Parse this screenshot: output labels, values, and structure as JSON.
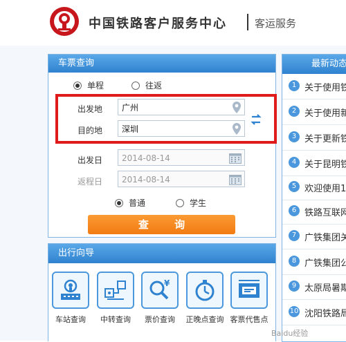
{
  "header": {
    "title": "中国铁路客户服务中心",
    "subtitle": "客运服务"
  },
  "ticket_query": {
    "panel_title": "车票查询",
    "trip_types": [
      "单程",
      "往返"
    ],
    "selected_trip_type": "单程",
    "from_label": "出发地",
    "from_value": "广州",
    "to_label": "目的地",
    "to_value": "深圳",
    "depart_label": "出发日",
    "depart_value": "2014-08-14",
    "return_label": "返程日",
    "return_value": "2014-08-14",
    "passenger_types": [
      "普通",
      "学生"
    ],
    "selected_passenger_type": "普通",
    "query_button": "查 询"
  },
  "travel_guide": {
    "panel_title": "出行向导",
    "items": [
      {
        "label": "车站查询",
        "icon": "station-icon"
      },
      {
        "label": "中转查询",
        "icon": "transfer-icon"
      },
      {
        "label": "票价查询",
        "icon": "price-search-icon"
      },
      {
        "label": "正晚点查询",
        "icon": "stopwatch-icon"
      },
      {
        "label": "客票代售点",
        "icon": "ticket-agency-icon"
      }
    ]
  },
  "news": {
    "panel_title": "最新动态",
    "items": [
      {
        "num": "1",
        "text": "关于使用铁"
      },
      {
        "num": "2",
        "text": "关于使用新"
      },
      {
        "num": "3",
        "text": "关于更新铁"
      },
      {
        "num": "4",
        "text": "关于昆明铁"
      },
      {
        "num": "5",
        "text": "欢迎使用1"
      },
      {
        "num": "6",
        "text": "铁路互联网"
      },
      {
        "num": "7",
        "text": "广铁集团关"
      },
      {
        "num": "8",
        "text": "广铁集团公"
      },
      {
        "num": "9",
        "text": "太原局暑期"
      },
      {
        "num": "10",
        "text": "沈阳铁路局"
      }
    ]
  },
  "watermark": "Baidu经验",
  "colors": {
    "accent_blue": "#2f82cf",
    "query_orange": "#f27b12",
    "highlight_red": "#e01b1b",
    "logo_red": "#c8161d"
  }
}
